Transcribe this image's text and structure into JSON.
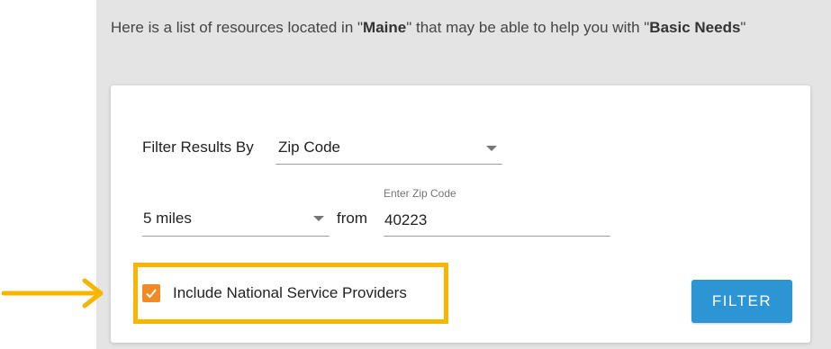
{
  "intro": {
    "prefix": "Here is a list of resources located in \"",
    "location": "Maine",
    "middle": "\" that may be able to help you with \"",
    "category": "Basic Needs",
    "suffix": "\""
  },
  "filter": {
    "filter_by_label": "Filter Results By",
    "filter_by_value": "Zip Code",
    "distance_value": "5 miles",
    "from_label": "from",
    "zip_label": "Enter Zip Code",
    "zip_value": "40223",
    "national_label": "Include National Service Providers",
    "national_checked": true,
    "button_label": "FILTER"
  },
  "colors": {
    "highlight": "#f7b500",
    "checkbox": "#f08a25",
    "button": "#2e95d4",
    "panel": "#e4e4e4"
  },
  "icons": {
    "annotation": "arrow-right-icon",
    "dropdown": "caret-down-icon",
    "check": "check-icon"
  }
}
